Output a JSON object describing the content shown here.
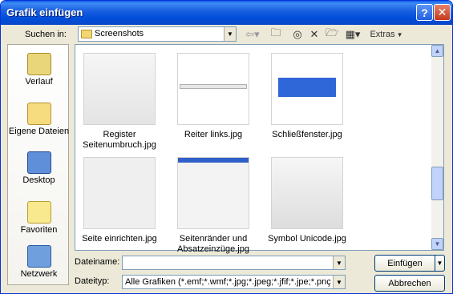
{
  "window": {
    "title": "Grafik einfügen"
  },
  "toolbar": {
    "look_in_label": "Suchen in:",
    "look_in_value": "Screenshots",
    "extras_label": "Extras"
  },
  "places": [
    {
      "label": "Verlauf",
      "icon": "history-icon"
    },
    {
      "label": "Eigene Dateien",
      "icon": "my-documents-icon"
    },
    {
      "label": "Desktop",
      "icon": "desktop-icon"
    },
    {
      "label": "Favoriten",
      "icon": "favorites-icon"
    },
    {
      "label": "Netzwerk",
      "icon": "network-icon"
    }
  ],
  "files": [
    {
      "name": "Register Seitenumbruch.jpg"
    },
    {
      "name": "Reiter links.jpg"
    },
    {
      "name": "Schließfenster.jpg"
    },
    {
      "name": "Seite einrichten.jpg"
    },
    {
      "name": "Seitenränder und Absatzeinzüge.jpg"
    },
    {
      "name": "Symbol Unicode.jpg"
    }
  ],
  "filename": {
    "label": "Dateiname:",
    "value": ""
  },
  "filetype": {
    "label": "Dateityp:",
    "value": "Alle Grafiken (*.emf;*.wmf;*.jpg;*.jpeg;*.jfif;*.jpe;*.pnç"
  },
  "buttons": {
    "insert": "Einfügen",
    "cancel": "Abbrechen"
  },
  "colors": {
    "title_bar": "#0054e3",
    "dialog_bg": "#ece9d8"
  }
}
